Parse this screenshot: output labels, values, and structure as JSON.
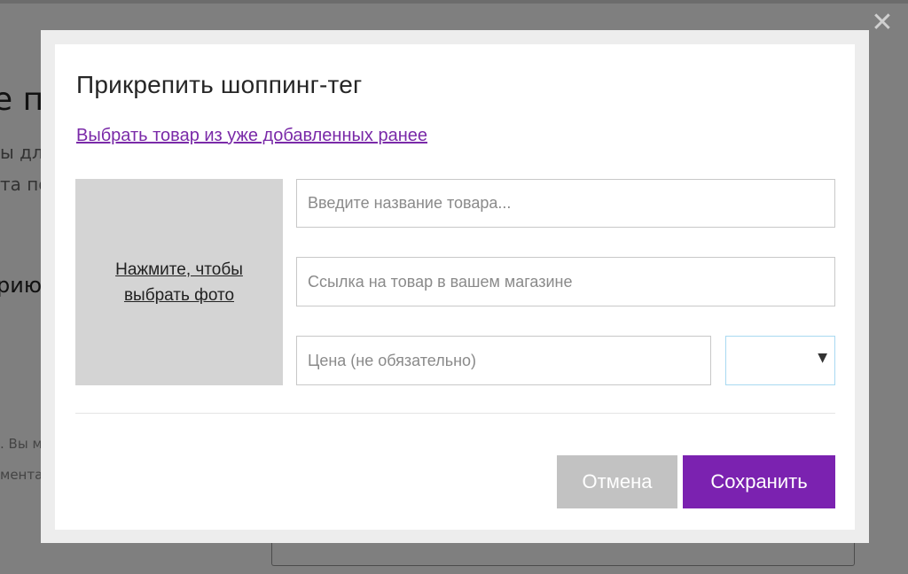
{
  "background": {
    "heading": "е п",
    "line1": "ы дл",
    "line2": "та по",
    "subheading": "рию",
    "small1": ". Вы м",
    "small2": "мента"
  },
  "modal": {
    "close_icon": "close-icon",
    "title": "Прикрепить шоппинг-тег",
    "choose_existing_link": "Выбрать товар из уже добавленных ранее",
    "photo_label": "Нажмите, чтобы выбрать фото",
    "fields": {
      "name_placeholder": "Введите название товара...",
      "link_placeholder": "Ссылка на товар в вашем магазине",
      "price_placeholder": "Цена (не обязательно)",
      "currency_value": ""
    },
    "buttons": {
      "cancel": "Отмена",
      "save": "Сохранить"
    }
  },
  "colors": {
    "accent": "#7b22b0",
    "link": "#7a2aa8",
    "cancel": "#c2c2c2",
    "photo_box": "#d4d4d4"
  }
}
